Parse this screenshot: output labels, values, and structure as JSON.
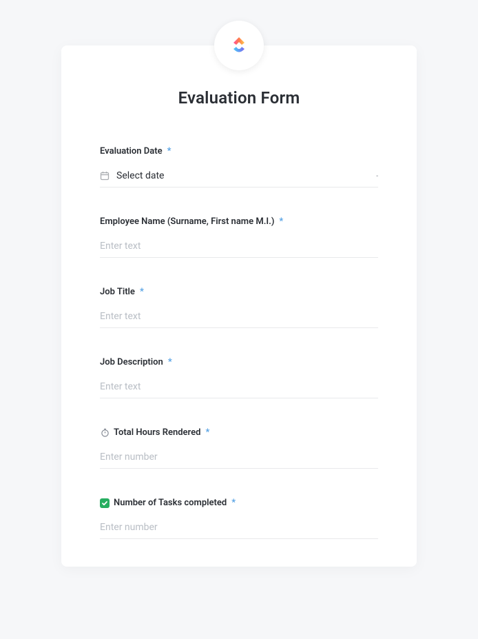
{
  "form": {
    "title": "Evaluation Form",
    "required_mark": "*",
    "fields": {
      "evaluation_date": {
        "label": "Evaluation Date",
        "placeholder": "Select date"
      },
      "employee_name": {
        "label": "Employee Name (Surname, First name M.I.)",
        "placeholder": "Enter text"
      },
      "job_title": {
        "label": "Job Title",
        "placeholder": "Enter text"
      },
      "job_description": {
        "label": "Job Description",
        "placeholder": "Enter text"
      },
      "total_hours": {
        "label": "Total Hours Rendered",
        "placeholder": "Enter number"
      },
      "tasks_completed": {
        "label": "Number of Tasks completed",
        "placeholder": "Enter number"
      }
    }
  },
  "icons": {
    "logo": "clickup-logo",
    "calendar": "calendar-icon",
    "stopwatch": "stopwatch-icon",
    "checkbox": "checkbox-icon",
    "caret": "-"
  },
  "colors": {
    "background": "#f6f7f9",
    "card": "#ffffff",
    "text_primary": "#2a2e34",
    "text_placeholder": "#b9bec5",
    "required": "#4f9ee3",
    "border": "#e8e9eb",
    "checkbox_green": "#27ae60"
  }
}
